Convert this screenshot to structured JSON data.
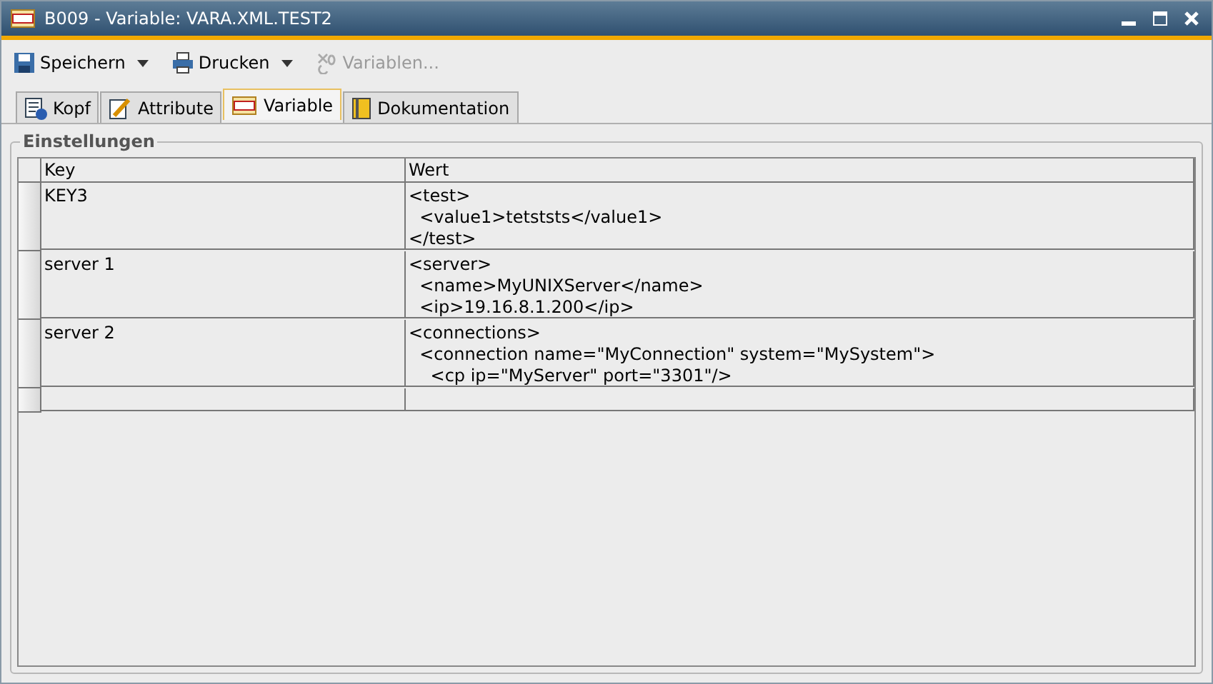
{
  "window": {
    "title": "B009 - Variable: VARA.XML.TEST2"
  },
  "toolbar": [
    {
      "label": "Speichern",
      "kind": "save",
      "dropdown": true,
      "disabled": false
    },
    {
      "label": "Drucken",
      "kind": "print",
      "dropdown": true,
      "disabled": false
    },
    {
      "label": "Variablen...",
      "kind": "vars",
      "dropdown": false,
      "disabled": true
    }
  ],
  "tabs": [
    {
      "label": "Kopf",
      "kind": "info",
      "selected": false
    },
    {
      "label": "Attribute",
      "kind": "edit",
      "selected": false
    },
    {
      "label": "Variable",
      "kind": "var",
      "selected": true
    },
    {
      "label": "Dokumentation",
      "kind": "doc",
      "selected": false
    }
  ],
  "group": {
    "title": "Einstellungen"
  },
  "table": {
    "columns": [
      "Key",
      "Wert"
    ],
    "rows": [
      {
        "key": "KEY3",
        "value": "<test>\n  <value1>tetststs</value1>\n</test>"
      },
      {
        "key": "server 1",
        "value": "<server>\n  <name>MyUNIXServer</name>\n  <ip>19.16.8.1.200</ip>"
      },
      {
        "key": "server 2",
        "value": "<connections>\n  <connection name=\"MyConnection\" system=\"MySystem\">\n    <cp ip=\"MyServer\" port=\"3301\"/>"
      }
    ],
    "blank_row": true
  }
}
